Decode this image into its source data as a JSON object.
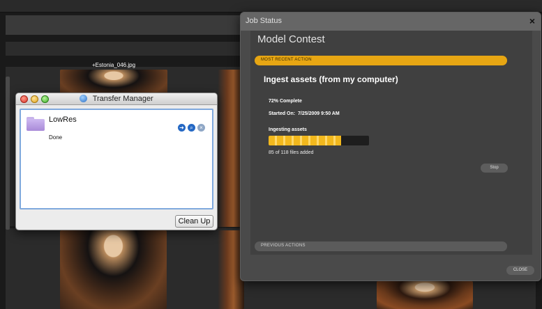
{
  "background": {
    "thumbnail_label": "+Estonia_046.jpg"
  },
  "transfer_manager": {
    "title": "Transfer Manager",
    "item": {
      "name": "LowRes",
      "status": "Done"
    },
    "cleanup_label": "Clean Up",
    "icons": [
      "reveal-arrow-icon",
      "magnify-icon",
      "stop-x-icon"
    ]
  },
  "job_status": {
    "window_title": "Job Status",
    "close_symbol": "×",
    "job_name": "Model Contest",
    "most_recent_action_label": "MOST RECENT ACTION",
    "action_title": "Ingest assets (from my computer)",
    "complete_text": "72% Complete",
    "started_text": "Started On:  7/25/2009 9:50 AM",
    "ingesting_label": "Ingesting assets",
    "progress": 0.72,
    "files_added_text": "85 of 118 files added",
    "stop_label": "Stop",
    "previous_actions_label": "PREVIOUS ACTIONS",
    "close_label": "CLOSE",
    "accent_color": "#e7a613"
  }
}
